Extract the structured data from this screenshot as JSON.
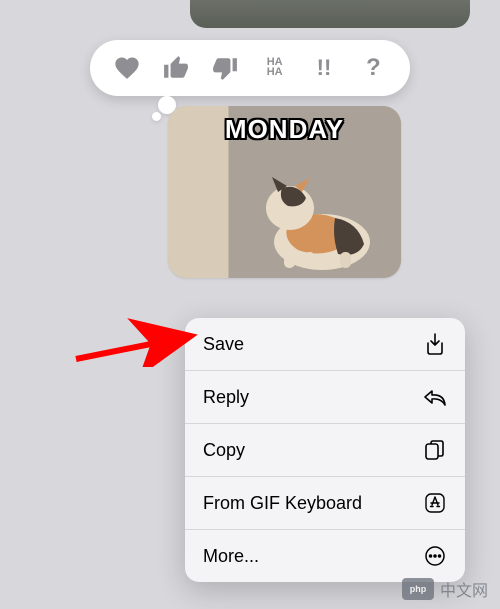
{
  "message": {
    "image_caption": "MONDAY"
  },
  "tapback": {
    "heart": "heart",
    "thumbs_up": "thumbs-up",
    "thumbs_down": "thumbs-down",
    "haha_top": "HA",
    "haha_bottom": "HA",
    "exclaim": "!!",
    "question": "?"
  },
  "menu": {
    "items": [
      {
        "label": "Save",
        "icon": "download"
      },
      {
        "label": "Reply",
        "icon": "reply"
      },
      {
        "label": "Copy",
        "icon": "copy"
      },
      {
        "label": "From GIF Keyboard",
        "icon": "appstore"
      },
      {
        "label": "More...",
        "icon": "more"
      }
    ]
  },
  "watermark": {
    "logo": "php",
    "text": "中文网"
  }
}
